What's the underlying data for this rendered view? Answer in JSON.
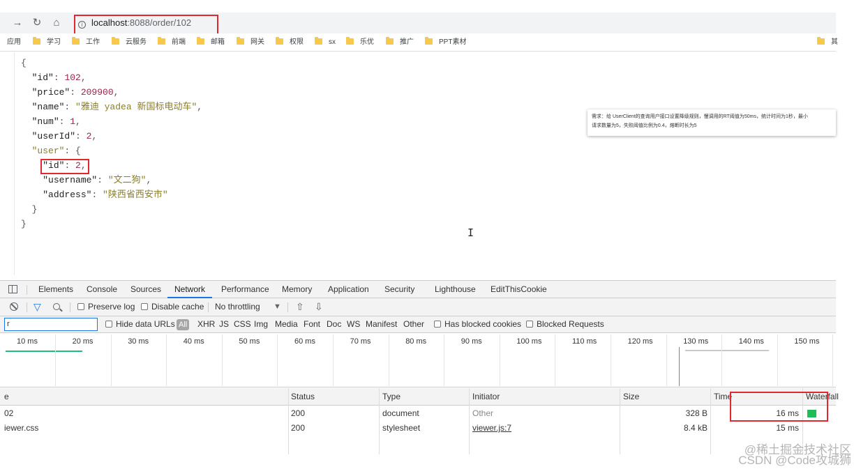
{
  "browser": {
    "address": {
      "host": "localhost",
      "path": ":8088/order/102"
    },
    "bookmarks": [
      "应用",
      "学习",
      "工作",
      "云服务",
      "前端",
      "邮箱",
      "网关",
      "权限",
      "sx",
      "乐优",
      "推广",
      "PPT素材",
      "其"
    ]
  },
  "json_view": {
    "lines": [
      [
        "{"
      ],
      [
        "  ",
        "\"id\"",
        ": ",
        "102",
        ","
      ],
      [
        "  ",
        "\"price\"",
        ": ",
        "209900",
        ","
      ],
      [
        "  ",
        "\"name\"",
        ": ",
        "\"雅迪 yadea 新国标电动车\"",
        ","
      ],
      [
        "  ",
        "\"num\"",
        ": ",
        "1",
        ","
      ],
      [
        "  ",
        "\"userId\"",
        ": ",
        "2",
        ","
      ],
      [
        "  ",
        "\"user\"",
        ": {"
      ],
      [
        "    ",
        "\"id\"",
        ": ",
        "2",
        ","
      ],
      [
        "    ",
        "\"username\"",
        ": ",
        "\"文二狗\"",
        ","
      ],
      [
        "    ",
        "\"address\"",
        ": ",
        "\"陕西省西安市\""
      ],
      [
        "  }"
      ],
      [
        "}"
      ]
    ],
    "cursor": "I"
  },
  "popup": {
    "line1": "需求：给 UserClient的查询用户接口设置降级规则，慢调用的RT阈值为50ms，统计时间为1秒，最小",
    "line2": "请求数量为5，失败阈值比例为0.4，熔断时长为5"
  },
  "devtools": {
    "tabs": [
      "Elements",
      "Console",
      "Sources",
      "Network",
      "Performance",
      "Memory",
      "Application",
      "Security",
      "Lighthouse",
      "EditThisCookie"
    ],
    "active_tab": "Network",
    "toolbar": {
      "preserve_log": "Preserve log",
      "disable_cache": "Disable cache",
      "throttling": "No throttling",
      "throttle_arrow": "▼",
      "upload": "⇧",
      "download": "⇩"
    },
    "filter": {
      "input_value": "r",
      "hide_data_urls": "Hide data URLs",
      "types": [
        "All",
        "XHR",
        "JS",
        "CSS",
        "Img",
        "Media",
        "Font",
        "Doc",
        "WS",
        "Manifest",
        "Other"
      ],
      "has_blocked_cookies": "Has blocked cookies",
      "blocked_requests": "Blocked Requests"
    },
    "timeline_ticks": [
      "10 ms",
      "20 ms",
      "30 ms",
      "40 ms",
      "50 ms",
      "60 ms",
      "70 ms",
      "80 ms",
      "90 ms",
      "100 ms",
      "110 ms",
      "120 ms",
      "130 ms",
      "140 ms",
      "150 ms"
    ],
    "table": {
      "headers": {
        "name": "e",
        "status": "Status",
        "type": "Type",
        "initiator": "Initiator",
        "size": "Size",
        "time": "Time",
        "waterfall": "Waterfall"
      },
      "rows": [
        {
          "name": "02",
          "status": "200",
          "type": "document",
          "initiator": "Other",
          "size": "328 B",
          "time": "16 ms"
        },
        {
          "name": "iewer.css",
          "status": "200",
          "type": "stylesheet",
          "initiator": "viewer.js:7",
          "size": "8.4 kB",
          "time": "15 ms"
        }
      ]
    }
  },
  "watermarks": {
    "line1": "@稀土掘金技术社区",
    "line2": "CSDN @Code攻城狮"
  },
  "colors": {
    "highlight": "#e0282e",
    "accent": "#1a73e8",
    "waterfall": "#1ebd5a"
  }
}
